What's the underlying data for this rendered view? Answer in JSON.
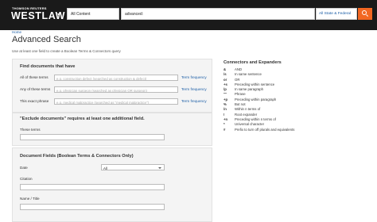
{
  "header": {
    "brand_top": "THOMSON REUTERS",
    "brand": "WESTLAW",
    "content_select": "All Content",
    "search_value": "advanced:",
    "jurisdiction": "All State & Federal",
    "search_icon": "search-icon",
    "accent_color": "#f26722"
  },
  "breadcrumb": {
    "home": "Home"
  },
  "page": {
    "title": "Advanced Search",
    "instructions": "Use at least one field to create a Boolean Terms & Connectors query"
  },
  "find_panel": {
    "title": "Find documents that have",
    "rows": [
      {
        "label": "All of these terms",
        "placeholder": "e.g.  construction defect (searched as construction & defect)",
        "link": "Term frequency"
      },
      {
        "label": "Any of these terms",
        "placeholder": "e.g.  physician surgeon (searched as physician OR surgeon)",
        "link": "Term frequency"
      },
      {
        "label": "This exact phrase",
        "placeholder": "e.g.  medical malpractice (searched as \"medical malpractice\")",
        "link": "Term frequency"
      }
    ]
  },
  "exclude_panel": {
    "title": "\"Exclude documents\" requires at least one additional field.",
    "label": "These terms"
  },
  "fields_panel": {
    "title": "Document Fields (Boolean Terms & Connectors Only)",
    "date_label": "Date",
    "date_value": "All",
    "citation_label": "Citation",
    "name_label": "Name / Title"
  },
  "connectors": {
    "title": "Connectors and Expanders",
    "items": [
      {
        "sym": "&",
        "desc": "AND"
      },
      {
        "sym": "/s",
        "desc": "In same sentence"
      },
      {
        "sym": "or",
        "desc": "OR"
      },
      {
        "sym": "+s",
        "desc": "Preceding within sentence"
      },
      {
        "sym": "/p",
        "desc": "In same paragraph"
      },
      {
        "sym": "\"\"",
        "desc": "Phrase"
      },
      {
        "sym": "+p",
        "desc": "Preceding within paragraph"
      },
      {
        "sym": "%",
        "desc": "But not"
      },
      {
        "sym": "/n",
        "desc": "Within n terms of"
      },
      {
        "sym": "!",
        "desc": "Root expander"
      },
      {
        "sym": "+n",
        "desc": "Preceding within n terms of"
      },
      {
        "sym": "*",
        "desc": "Universal character"
      },
      {
        "sym": "#",
        "desc": "Prefix to turn off plurals and equivalents"
      }
    ]
  }
}
